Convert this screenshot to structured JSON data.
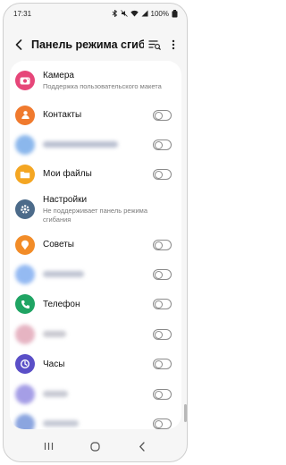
{
  "status": {
    "time": "17:31",
    "battery": "100%"
  },
  "header": {
    "title": "Панель режима сгибания"
  },
  "apps": [
    {
      "name": "Камера",
      "subtitle": "Поддержка пользовательского макета",
      "icon": "camera-icon",
      "color": "#e64679",
      "control": "none"
    },
    {
      "name": "Контакты",
      "icon": "contacts-icon",
      "color": "#f07a2e",
      "control": "switch"
    },
    {
      "name": "",
      "icon": "blurred-app-icon",
      "color": "#6fa6e8",
      "control": "switch",
      "blurred": true
    },
    {
      "name": "Мои файлы",
      "icon": "folder-icon",
      "color": "#f4a623",
      "control": "switch"
    },
    {
      "name": "Настройки",
      "subtitle": "Не поддерживает панель режима сгибания",
      "icon": "settings-gear-icon",
      "color": "#4c6b8a",
      "control": "none"
    },
    {
      "name": "Советы",
      "icon": "tips-icon",
      "color": "#f28c28",
      "control": "switch"
    },
    {
      "name": "",
      "icon": "blurred-app-icon",
      "color": "#7aa9f0",
      "control": "switch",
      "blurred": true
    },
    {
      "name": "Телефон",
      "icon": "phone-icon",
      "color": "#1fa463",
      "control": "switch"
    },
    {
      "name": "",
      "icon": "blurred-app-icon",
      "color": "#e0a2b4",
      "control": "switch",
      "blurred": true
    },
    {
      "name": "Часы",
      "icon": "clock-icon",
      "color": "#5a4fc7",
      "control": "switch"
    },
    {
      "name": "",
      "icon": "blurred-app-icon",
      "color": "#8f86e0",
      "control": "switch",
      "blurred": true
    },
    {
      "name": "",
      "icon": "blurred-app-icon",
      "color": "#6f8fd8",
      "control": "switch",
      "blurred": true
    }
  ]
}
